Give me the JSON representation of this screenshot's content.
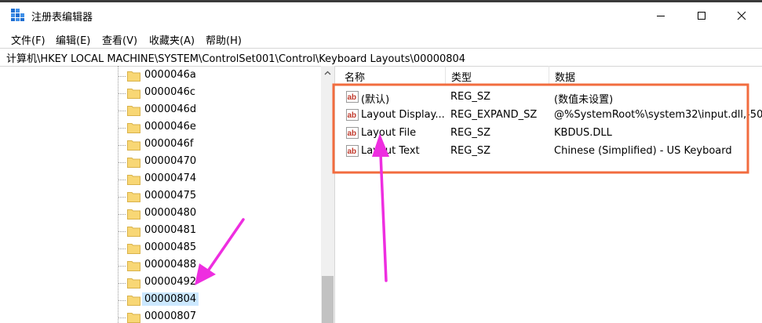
{
  "window": {
    "title": "注册表编辑器",
    "app_icon": "registry-editor-icon"
  },
  "menu": [
    "文件(F)",
    "编辑(E)",
    "查看(V)",
    "收藏夹(A)",
    "帮助(H)"
  ],
  "address_path": "计算机\\HKEY LOCAL MACHINE\\SYSTEM\\ControlSet001\\Control\\Keyboard Layouts\\00000804",
  "tree": {
    "items": [
      "0000046a",
      "0000046c",
      "0000046d",
      "0000046e",
      "0000046f",
      "00000470",
      "00000474",
      "00000475",
      "00000480",
      "00000481",
      "00000485",
      "00000488",
      "00000492",
      "00000804",
      "00000807"
    ],
    "selected": "00000804"
  },
  "columns": {
    "name": "名称",
    "type": "类型",
    "data": "数据"
  },
  "values": [
    {
      "name": "(默认)",
      "type": "REG_SZ",
      "data": "(数值未设置)"
    },
    {
      "name": "Layout Display...",
      "type": "REG_EXPAND_SZ",
      "data": "@%SystemRoot%\\system32\\input.dll,-50"
    },
    {
      "name": "Layout File",
      "type": "REG_SZ",
      "data": "KBDUS.DLL"
    },
    {
      "name": "Layout Text",
      "type": "REG_SZ",
      "data": "Chinese (Simplified) - US Keyboard"
    }
  ],
  "colors": {
    "highlight_box": "#f26c3f",
    "arrow": "#ee2ee0",
    "selection": "#cce8ff",
    "folder": "#f8d775"
  }
}
